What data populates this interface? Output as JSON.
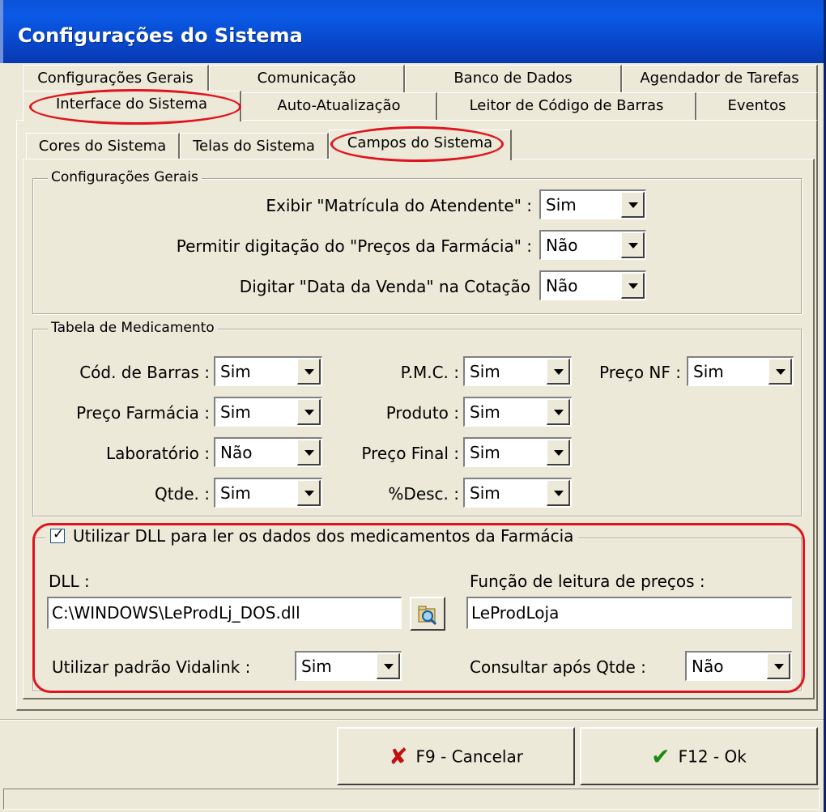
{
  "window": {
    "title": "Configurações do Sistema"
  },
  "tabs_row1": [
    "Configurações Gerais",
    "Comunicação",
    "Banco de Dados",
    "Agendador de Tarefas"
  ],
  "tabs_row2": [
    "Interface do Sistema",
    "Auto-Atualização",
    "Leitor de Código de Barras",
    "Eventos"
  ],
  "subtabs": [
    "Cores do Sistema",
    "Telas do Sistema",
    "Campos do Sistema"
  ],
  "config_gerais": {
    "title": "Configurações Gerais",
    "rows": [
      {
        "label": "Exibir \"Matrícula do Atendente\" :",
        "value": "Sim"
      },
      {
        "label": "Permitir digitação do \"Preços da Farmácia\" :",
        "value": "Não"
      },
      {
        "label": "Digitar \"Data da Venda\" na Cotação",
        "value": "Não"
      }
    ]
  },
  "tabela": {
    "title": "Tabela de Medicamento",
    "cod_barras": {
      "label": "Cód. de Barras :",
      "value": "Sim"
    },
    "preco_farmacia": {
      "label": "Preço Farmácia :",
      "value": "Sim"
    },
    "laboratorio": {
      "label": "Laboratório :",
      "value": "Não"
    },
    "qtde": {
      "label": "Qtde. :",
      "value": "Sim"
    },
    "pmc": {
      "label": "P.M.C. :",
      "value": "Sim"
    },
    "produto": {
      "label": "Produto :",
      "value": "Sim"
    },
    "preco_final": {
      "label": "Preço Final :",
      "value": "Sim"
    },
    "desc": {
      "label": "%Desc. :",
      "value": "Sim"
    },
    "preco_nf": {
      "label": "Preço NF :",
      "value": "Sim"
    }
  },
  "dll": {
    "checkbox_label": "Utilizar DLL para ler os dados dos medicamentos da Farmácia",
    "checked": true,
    "dll_label": "DLL :",
    "dll_value": "C:\\WINDOWS\\LeProdLj_DOS.dll",
    "funcao_label": "Função de leitura de preços :",
    "funcao_value": "LeProdLoja",
    "vidalink_label": "Utilizar padrão Vidalink :",
    "vidalink_value": "Sim",
    "consultar_label": "Consultar após Qtde :",
    "consultar_value": "Não"
  },
  "buttons": {
    "cancel": "F9 - Cancelar",
    "ok": "F12 - Ok"
  },
  "colors": {
    "annotation": "#e0141e",
    "titlebar": "#0a5ae6",
    "face": "#ece9d8"
  }
}
